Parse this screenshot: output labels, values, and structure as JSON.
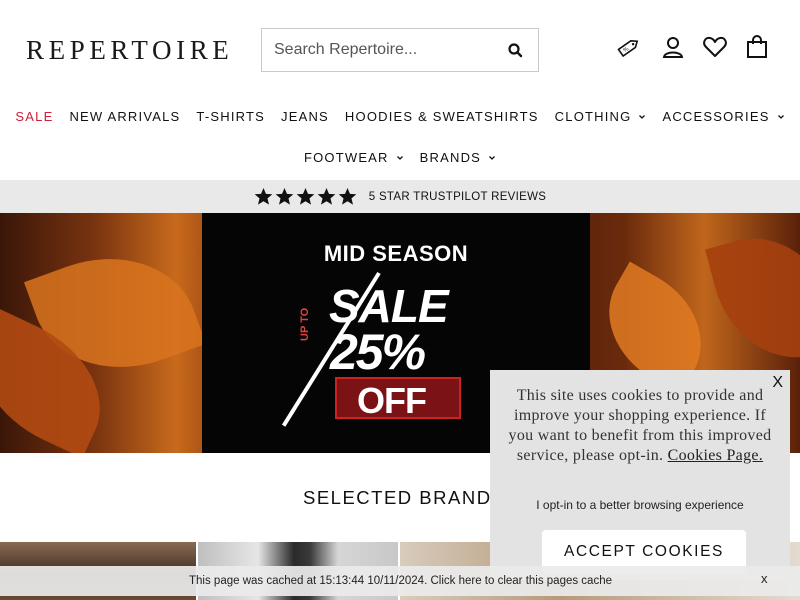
{
  "header": {
    "logo": "REPERTOIRE",
    "search_placeholder": "Search Repertoire...",
    "icons": [
      "search-icon",
      "discount-tag-icon",
      "account-icon",
      "wishlist-heart-icon",
      "bag-icon"
    ]
  },
  "nav": {
    "row1": [
      {
        "label": "SALE",
        "dropdown": false,
        "highlight": true
      },
      {
        "label": "NEW ARRIVALS",
        "dropdown": false
      },
      {
        "label": "T-SHIRTS",
        "dropdown": false
      },
      {
        "label": "JEANS",
        "dropdown": false
      },
      {
        "label": "HOODIES & SWEATSHIRTS",
        "dropdown": false
      },
      {
        "label": "CLOTHING",
        "dropdown": true
      },
      {
        "label": "ACCESSORIES",
        "dropdown": true
      }
    ],
    "row2": [
      {
        "label": "FOOTWEAR",
        "dropdown": true
      },
      {
        "label": "BRANDS",
        "dropdown": true
      }
    ]
  },
  "trust_bar": {
    "stars": 5,
    "text": "5 STAR TRUSTPILOT REVIEWS"
  },
  "hero": {
    "title": "MID SEASON",
    "sale": "SALE",
    "up_to": "UP TO",
    "percent": "25%",
    "off": "OFF"
  },
  "brands_section": {
    "title": "SELECTED BRANDS"
  },
  "cookie_popup": {
    "close": "X",
    "text": "This site uses cookies to provide and improve your shopping experience. If you want to benefit from this improved service, please opt-in.",
    "link": "Cookies Page.",
    "optin": "I opt-in to a better browsing experience",
    "accept": "ACCEPT COOKIES"
  },
  "cache_bar": {
    "text": "This page was cached at 15:13:44 10/11/2024. Click here to clear this pages cache",
    "close": "x"
  },
  "colors": {
    "sale_red": "#d0203a",
    "trust_bar_bg": "#e9e9e9",
    "cookie_bg": "#e3e3e3"
  }
}
